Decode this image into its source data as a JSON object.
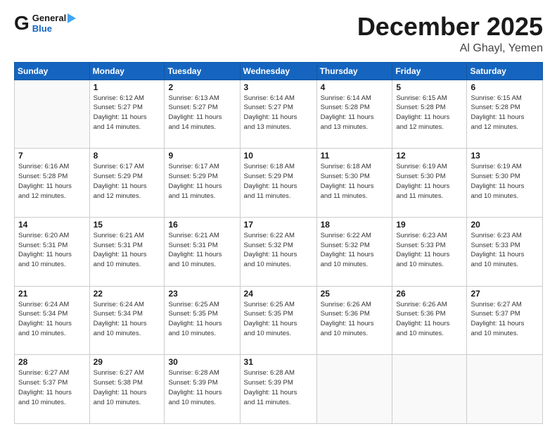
{
  "logo": {
    "general": "General",
    "blue": "Blue"
  },
  "header": {
    "month": "December 2025",
    "location": "Al Ghayl, Yemen"
  },
  "weekdays": [
    "Sunday",
    "Monday",
    "Tuesday",
    "Wednesday",
    "Thursday",
    "Friday",
    "Saturday"
  ],
  "weeks": [
    [
      {
        "day": "",
        "info": ""
      },
      {
        "day": "1",
        "info": "Sunrise: 6:12 AM\nSunset: 5:27 PM\nDaylight: 11 hours\nand 14 minutes."
      },
      {
        "day": "2",
        "info": "Sunrise: 6:13 AM\nSunset: 5:27 PM\nDaylight: 11 hours\nand 14 minutes."
      },
      {
        "day": "3",
        "info": "Sunrise: 6:14 AM\nSunset: 5:27 PM\nDaylight: 11 hours\nand 13 minutes."
      },
      {
        "day": "4",
        "info": "Sunrise: 6:14 AM\nSunset: 5:28 PM\nDaylight: 11 hours\nand 13 minutes."
      },
      {
        "day": "5",
        "info": "Sunrise: 6:15 AM\nSunset: 5:28 PM\nDaylight: 11 hours\nand 12 minutes."
      },
      {
        "day": "6",
        "info": "Sunrise: 6:15 AM\nSunset: 5:28 PM\nDaylight: 11 hours\nand 12 minutes."
      }
    ],
    [
      {
        "day": "7",
        "info": "Sunrise: 6:16 AM\nSunset: 5:28 PM\nDaylight: 11 hours\nand 12 minutes."
      },
      {
        "day": "8",
        "info": "Sunrise: 6:17 AM\nSunset: 5:29 PM\nDaylight: 11 hours\nand 12 minutes."
      },
      {
        "day": "9",
        "info": "Sunrise: 6:17 AM\nSunset: 5:29 PM\nDaylight: 11 hours\nand 11 minutes."
      },
      {
        "day": "10",
        "info": "Sunrise: 6:18 AM\nSunset: 5:29 PM\nDaylight: 11 hours\nand 11 minutes."
      },
      {
        "day": "11",
        "info": "Sunrise: 6:18 AM\nSunset: 5:30 PM\nDaylight: 11 hours\nand 11 minutes."
      },
      {
        "day": "12",
        "info": "Sunrise: 6:19 AM\nSunset: 5:30 PM\nDaylight: 11 hours\nand 11 minutes."
      },
      {
        "day": "13",
        "info": "Sunrise: 6:19 AM\nSunset: 5:30 PM\nDaylight: 11 hours\nand 10 minutes."
      }
    ],
    [
      {
        "day": "14",
        "info": "Sunrise: 6:20 AM\nSunset: 5:31 PM\nDaylight: 11 hours\nand 10 minutes."
      },
      {
        "day": "15",
        "info": "Sunrise: 6:21 AM\nSunset: 5:31 PM\nDaylight: 11 hours\nand 10 minutes."
      },
      {
        "day": "16",
        "info": "Sunrise: 6:21 AM\nSunset: 5:31 PM\nDaylight: 11 hours\nand 10 minutes."
      },
      {
        "day": "17",
        "info": "Sunrise: 6:22 AM\nSunset: 5:32 PM\nDaylight: 11 hours\nand 10 minutes."
      },
      {
        "day": "18",
        "info": "Sunrise: 6:22 AM\nSunset: 5:32 PM\nDaylight: 11 hours\nand 10 minutes."
      },
      {
        "day": "19",
        "info": "Sunrise: 6:23 AM\nSunset: 5:33 PM\nDaylight: 11 hours\nand 10 minutes."
      },
      {
        "day": "20",
        "info": "Sunrise: 6:23 AM\nSunset: 5:33 PM\nDaylight: 11 hours\nand 10 minutes."
      }
    ],
    [
      {
        "day": "21",
        "info": "Sunrise: 6:24 AM\nSunset: 5:34 PM\nDaylight: 11 hours\nand 10 minutes."
      },
      {
        "day": "22",
        "info": "Sunrise: 6:24 AM\nSunset: 5:34 PM\nDaylight: 11 hours\nand 10 minutes."
      },
      {
        "day": "23",
        "info": "Sunrise: 6:25 AM\nSunset: 5:35 PM\nDaylight: 11 hours\nand 10 minutes."
      },
      {
        "day": "24",
        "info": "Sunrise: 6:25 AM\nSunset: 5:35 PM\nDaylight: 11 hours\nand 10 minutes."
      },
      {
        "day": "25",
        "info": "Sunrise: 6:26 AM\nSunset: 5:36 PM\nDaylight: 11 hours\nand 10 minutes."
      },
      {
        "day": "26",
        "info": "Sunrise: 6:26 AM\nSunset: 5:36 PM\nDaylight: 11 hours\nand 10 minutes."
      },
      {
        "day": "27",
        "info": "Sunrise: 6:27 AM\nSunset: 5:37 PM\nDaylight: 11 hours\nand 10 minutes."
      }
    ],
    [
      {
        "day": "28",
        "info": "Sunrise: 6:27 AM\nSunset: 5:37 PM\nDaylight: 11 hours\nand 10 minutes."
      },
      {
        "day": "29",
        "info": "Sunrise: 6:27 AM\nSunset: 5:38 PM\nDaylight: 11 hours\nand 10 minutes."
      },
      {
        "day": "30",
        "info": "Sunrise: 6:28 AM\nSunset: 5:39 PM\nDaylight: 11 hours\nand 10 minutes."
      },
      {
        "day": "31",
        "info": "Sunrise: 6:28 AM\nSunset: 5:39 PM\nDaylight: 11 hours\nand 11 minutes."
      },
      {
        "day": "",
        "info": ""
      },
      {
        "day": "",
        "info": ""
      },
      {
        "day": "",
        "info": ""
      }
    ]
  ]
}
